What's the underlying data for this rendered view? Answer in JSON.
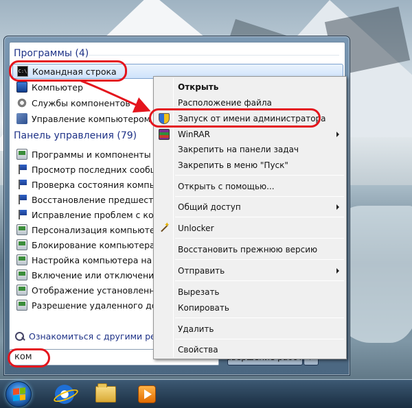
{
  "start_menu": {
    "programs_header": "Программы (4)",
    "programs": [
      {
        "label": "Командная строка",
        "icon": "cmd-icon"
      },
      {
        "label": "Компьютер",
        "icon": "computer-icon"
      },
      {
        "label": "Службы компонентов",
        "icon": "gear-icon"
      },
      {
        "label": "Управление компьютером",
        "icon": "computer-management-icon"
      }
    ],
    "control_panel_header": "Панель управления (79)",
    "control_panel": [
      {
        "label": "Программы и компоненты",
        "icon": "control-panel-icon"
      },
      {
        "label": "Просмотр последних сообще",
        "icon": "flag-icon"
      },
      {
        "label": "Проверка состояния компьюто",
        "icon": "flag-icon"
      },
      {
        "label": "Восстановление предшеству",
        "icon": "flag-icon"
      },
      {
        "label": "Исправление проблем с комп",
        "icon": "flag-icon"
      },
      {
        "label": "Персонализация компьютера",
        "icon": "control-panel-icon"
      },
      {
        "label": "Блокирование компьютера, о",
        "icon": "control-panel-icon"
      },
      {
        "label": "Настройка компьютера на ис",
        "icon": "control-panel-icon"
      },
      {
        "label": "Включение или отключение к",
        "icon": "control-panel-icon"
      },
      {
        "label": "Отображение установленных",
        "icon": "control-panel-icon"
      },
      {
        "label": "Разрешение удаленного досту",
        "icon": "control-panel-icon"
      }
    ],
    "see_more": "Ознакомиться с другими результ",
    "search_value": "ком",
    "shutdown_label": "Завершение работы"
  },
  "context_menu": {
    "items": [
      {
        "label": "Открыть",
        "bold": true
      },
      {
        "label": "Расположение файла"
      },
      {
        "label": "Запуск от имени администратора",
        "icon": "shield-icon"
      },
      {
        "label": "WinRAR",
        "icon": "winrar-icon",
        "submenu": true
      },
      {
        "label": "Закрепить на панели задач"
      },
      {
        "label": "Закрепить в меню \"Пуск\""
      },
      {
        "label": "Открыть с помощью..."
      },
      {
        "label": "Общий доступ",
        "submenu": true
      },
      {
        "label": "Unlocker",
        "icon": "unlocker-icon"
      },
      {
        "label": "Восстановить прежнюю версию"
      },
      {
        "label": "Отправить",
        "submenu": true
      },
      {
        "label": "Вырезать"
      },
      {
        "label": "Копировать"
      },
      {
        "label": "Удалить"
      },
      {
        "label": "Свойства"
      }
    ]
  },
  "taskbar": {
    "apps": [
      "start-orb-icon",
      "internet-explorer-icon",
      "file-explorer-icon",
      "media-player-icon"
    ]
  },
  "colors": {
    "annotation": "#e4151d",
    "header_text": "#1e3287",
    "selection": "#cfe3fb"
  }
}
